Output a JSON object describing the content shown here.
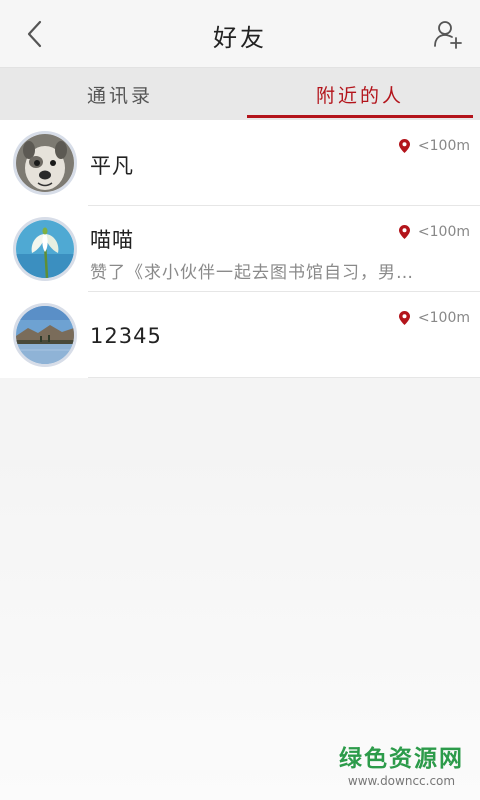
{
  "header": {
    "title": "好友",
    "back_icon": "chevron-left-icon",
    "add_icon": "add-user-icon"
  },
  "tabs": [
    {
      "label": "通讯录",
      "active": false
    },
    {
      "label": "附近的人",
      "active": true
    }
  ],
  "colors": {
    "accent": "#b3141b",
    "watermark_green": "#2c9b4a"
  },
  "nearby": [
    {
      "name": "平凡",
      "status": "",
      "distance": "<100m",
      "avatar": "dog-photo"
    },
    {
      "name": "喵喵",
      "status": "赞了《求小伙伴一起去图书馆自习，男…",
      "distance": "<100m",
      "avatar": "flower-photo"
    },
    {
      "name": "12345",
      "status": "",
      "distance": "<100m",
      "avatar": "lake-landscape-photo"
    }
  ],
  "watermark": {
    "title": "绿色资源网",
    "url": "www.downcc.com"
  }
}
